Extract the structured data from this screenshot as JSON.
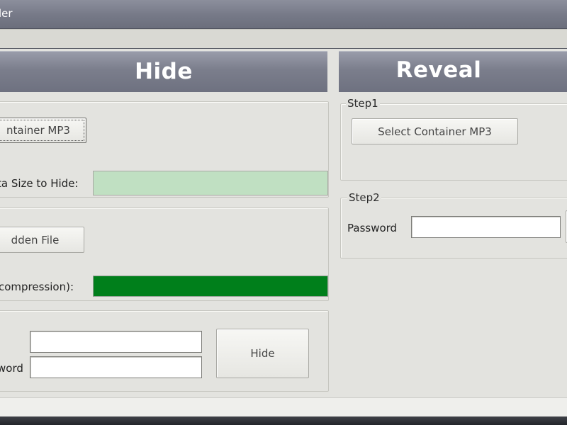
{
  "window": {
    "title": "ler"
  },
  "tabs": {
    "hide": "Hide",
    "reveal": "Reveal"
  },
  "hide_panel": {
    "select_container_button": "ntainer MP3",
    "data_size_label": "ta Size to Hide:",
    "data_size_fill": 1.0,
    "select_hidden_button": "dden File",
    "compression_label": "compression):",
    "compression_fill": 1.0,
    "password_label": "word",
    "hide_button": "Hide"
  },
  "reveal_panel": {
    "step1_label": "Step1",
    "select_container_button": "Select Container MP3",
    "step2_label": "Step2",
    "password_label": "Password"
  },
  "colors": {
    "data_size_bar": "#c0e0c2",
    "compression_bar": "#007f1b"
  }
}
